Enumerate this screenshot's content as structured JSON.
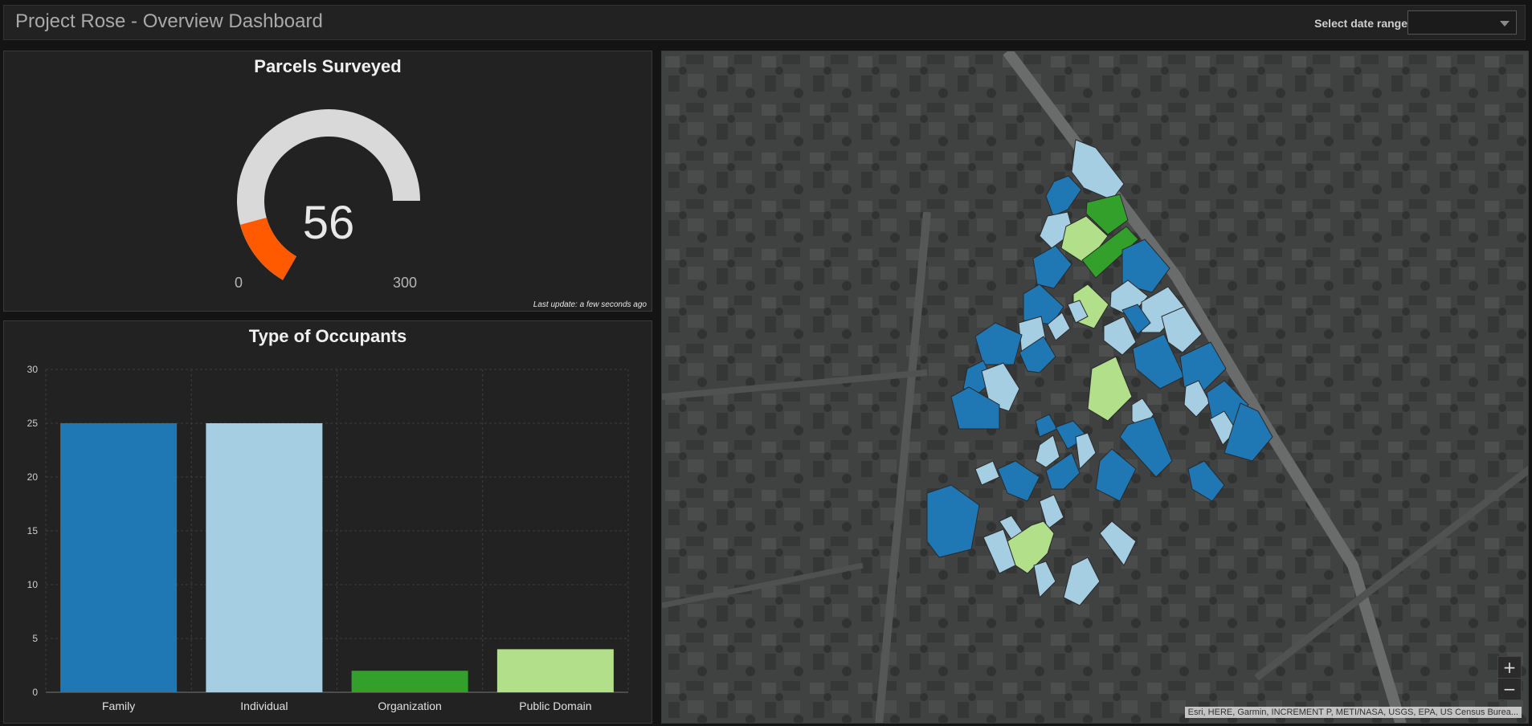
{
  "header": {
    "title": "Project Rose - Overview Dashboard",
    "date_range_label": "Select date range",
    "date_range_value": ""
  },
  "gauge": {
    "title": "Parcels Surveyed",
    "value": 56,
    "min": 0,
    "max": 300,
    "min_label": "0",
    "max_label": "300",
    "value_label": "56",
    "fill_color": "#ff5a00",
    "track_color": "#d9d9d9",
    "last_update": "Last update: a few seconds ago"
  },
  "chart_data": {
    "type": "bar",
    "title": "Type of Occupants",
    "categories": [
      "Family",
      "Individual",
      "Organization",
      "Public Domain"
    ],
    "values": [
      25,
      25,
      2,
      4
    ],
    "colors": [
      "#1f78b4",
      "#a6cee3",
      "#33a02c",
      "#b2df8a"
    ],
    "ylim": [
      0,
      30
    ],
    "yticks": [
      0,
      5,
      10,
      15,
      20,
      25,
      30
    ],
    "grid": true
  },
  "map": {
    "attribution": "Esri, HERE, Garmin, INCREMENT P, METI/NASA, USGS, EPA, US Census Burea...",
    "zoom_in_label": "+",
    "zoom_out_label": "−",
    "parcel_colors": {
      "Family": "#1f78b4",
      "Individual": "#a6cee3",
      "Organization": "#33a02c",
      "Public Domain": "#b2df8a"
    }
  }
}
